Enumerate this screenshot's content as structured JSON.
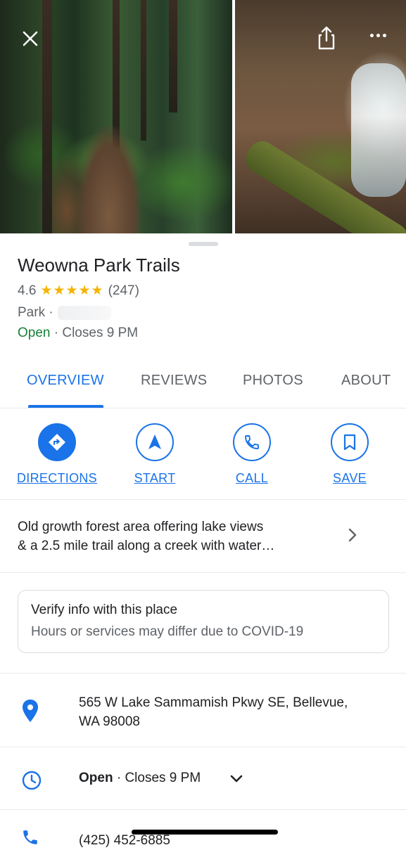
{
  "header": {
    "close_icon": "close-icon",
    "share_icon": "share-icon",
    "more_icon": "more-icon"
  },
  "place": {
    "name": "Weowna Park Trails",
    "rating": "4.6",
    "stars": "★★★★★",
    "review_count": "(247)",
    "type": "Park ·",
    "open_status": "Open",
    "closes": " · Closes 9 PM"
  },
  "tabs": [
    {
      "label": "OVERVIEW",
      "active": true
    },
    {
      "label": "REVIEWS",
      "active": false
    },
    {
      "label": "PHOTOS",
      "active": false
    },
    {
      "label": "ABOUT",
      "active": false
    }
  ],
  "actions": [
    {
      "label": "DIRECTIONS",
      "icon": "directions-icon"
    },
    {
      "label": "START",
      "icon": "navigation-arrow-icon"
    },
    {
      "label": "CALL",
      "icon": "phone-icon"
    },
    {
      "label": "SAVE",
      "icon": "bookmark-icon"
    }
  ],
  "description": {
    "line1": "Old growth forest area offering lake views",
    "line2": "& a 2.5 mile trail along a creek with water…"
  },
  "verify": {
    "title": "Verify info with this place",
    "subtitle": "Hours or services may differ due to COVID-19"
  },
  "info": {
    "address_line1": "565 W Lake Sammamish Pkwy SE, Bellevue,",
    "address_line2": "WA 98008",
    "hours_open": "Open",
    "hours_closes": " · Closes 9 PM",
    "phone": "(425) 452-6885"
  },
  "colors": {
    "accent": "#1a73e8",
    "open_green": "#188038",
    "star": "#f4b400"
  }
}
